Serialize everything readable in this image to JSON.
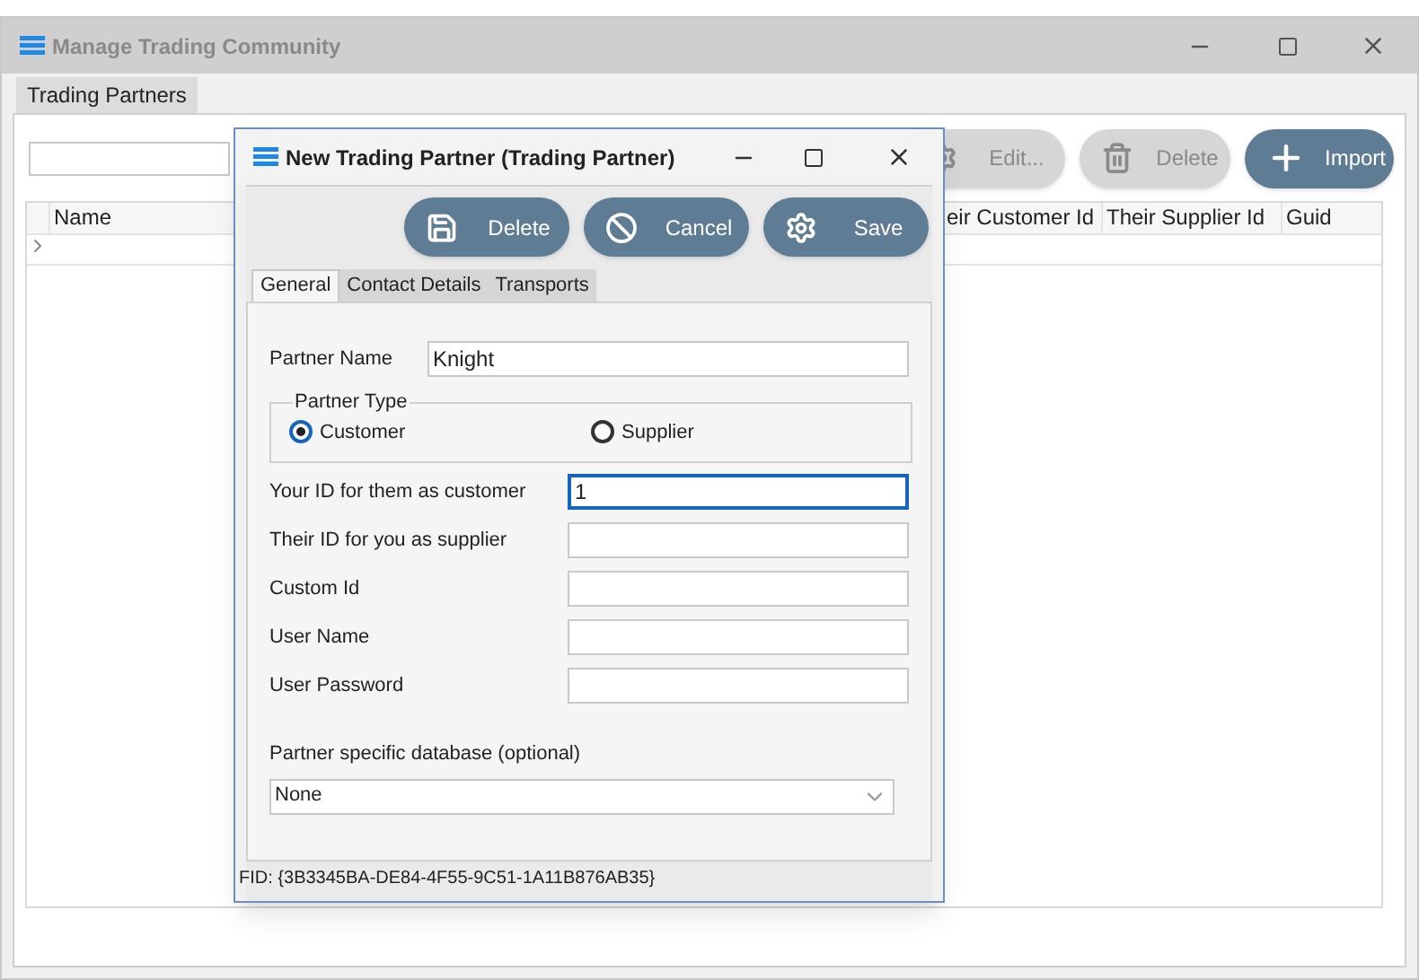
{
  "window": {
    "title": "Manage Trading Community"
  },
  "tabs": [
    {
      "label": "Trading Partners",
      "selected": true
    }
  ],
  "toolbar": [
    {
      "label": "Edit...",
      "kind": "edit",
      "disabled": true
    },
    {
      "label": "Delete",
      "kind": "delete",
      "disabled": true
    },
    {
      "label": "Import",
      "kind": "import",
      "disabled": false
    }
  ],
  "table": {
    "columns": [
      "Name",
      "eir Customer Id",
      "Their Supplier Id",
      "Guid"
    ]
  },
  "dialog": {
    "title": "New Trading Partner (Trading Partner)",
    "buttons": [
      {
        "label": "Delete",
        "kind": "save"
      },
      {
        "label": "Cancel",
        "kind": "cancel"
      },
      {
        "label": "Save",
        "kind": "settings"
      }
    ],
    "tabs": [
      {
        "label": "General",
        "selected": true
      },
      {
        "label": "Contact Details",
        "selected": false
      },
      {
        "label": "Transports",
        "selected": false
      }
    ],
    "partner_name": {
      "label": "Partner Name",
      "value": "Knight"
    },
    "partner_type": {
      "legend": "Partner Type",
      "options": [
        {
          "label": "Customer",
          "selected": true
        },
        {
          "label": "Supplier",
          "selected": false
        }
      ]
    },
    "fields": [
      {
        "label": "Your ID for them as customer",
        "value": "1",
        "focused": true
      },
      {
        "label": "Their ID for you as supplier",
        "focused": false
      },
      {
        "label": "Custom Id",
        "focused": false
      },
      {
        "label": "User Name",
        "focused": false
      },
      {
        "label": "User Password",
        "focused": false
      }
    ],
    "database": {
      "label": "Partner specific database (optional)",
      "value": "None"
    },
    "fid": "FID: {3B3345BA-DE84-4F55-9C51-1A11B876AB35}"
  }
}
